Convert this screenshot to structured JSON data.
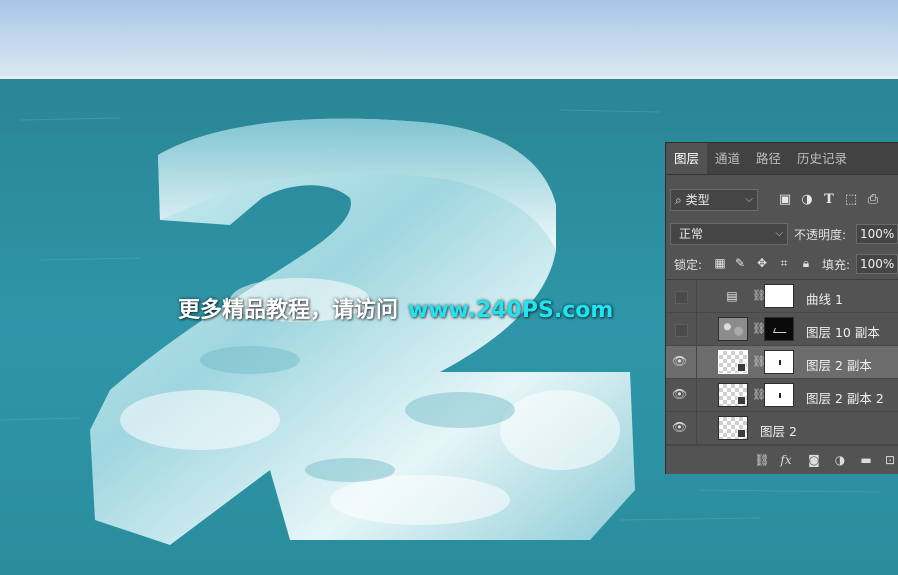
{
  "watermark": {
    "text": "更多精品教程，请访问",
    "url": "www.240PS.com"
  },
  "panel": {
    "tabs": [
      {
        "label": "图层",
        "active": true
      },
      {
        "label": "通道",
        "active": false
      },
      {
        "label": "路径",
        "active": false
      },
      {
        "label": "历史记录",
        "active": false
      }
    ],
    "filter": {
      "kind_label": "类型",
      "search_icon": "search-icon",
      "icons": [
        "image-filter-icon",
        "adjustment-filter-icon",
        "type-filter-icon",
        "shape-filter-icon",
        "smart-object-filter-icon"
      ]
    },
    "blend": {
      "mode": "正常",
      "opacity_label": "不透明度:",
      "opacity_value": "100%"
    },
    "lock": {
      "label": "锁定:",
      "fill_label": "填充:",
      "fill_value": "100%"
    },
    "layers": [
      {
        "name": "曲线 1",
        "visible": false,
        "type": "adjustment",
        "mask": "white"
      },
      {
        "name": "图层 10 副本",
        "visible": false,
        "type": "noise",
        "mask": "black"
      },
      {
        "name": "图层 2 副本",
        "visible": true,
        "type": "smart",
        "mask": "white",
        "selected": true
      },
      {
        "name": "图层 2 副本 2",
        "visible": true,
        "type": "smart",
        "mask": "white"
      },
      {
        "name": "图层 2",
        "visible": true,
        "type": "smart",
        "mask": null
      }
    ],
    "footer_fx": "fx"
  },
  "colors": {
    "sky_top": "#a9c8e8",
    "sea": "#2b8e9f",
    "watermark_url": "#22e3f2",
    "panel_bg": "#535353"
  }
}
